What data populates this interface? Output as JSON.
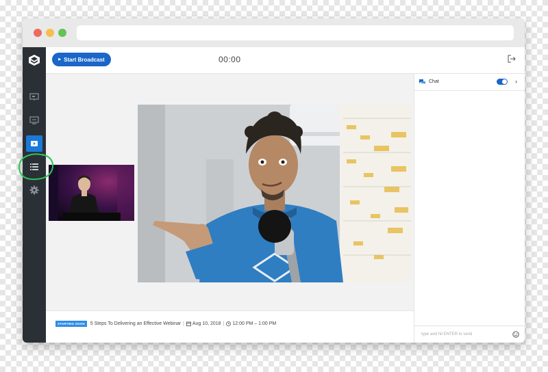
{
  "window": {
    "url": ""
  },
  "sidebar": {
    "items": [
      {
        "icon": "presentation-icon"
      },
      {
        "icon": "screen-share-icon"
      },
      {
        "icon": "video-camera-icon",
        "active": true
      },
      {
        "icon": "list-icon"
      },
      {
        "icon": "gear-icon"
      }
    ]
  },
  "toolbar": {
    "start_label": "Start Broadcast",
    "timer": "00:00"
  },
  "webinar": {
    "status_badge": "STARTING SOON",
    "title": "5 Steps To Delivering an Effective Webinar",
    "date": "Aug 10, 2018",
    "time": "12:00 PM – 1:00 PM"
  },
  "chat": {
    "title": "Chat",
    "toggle_on": true,
    "input_placeholder": "type and hit ENTER to send"
  },
  "colors": {
    "accent": "#1a66c9",
    "sidebar": "#2b3036",
    "badge": "#2e8ce6",
    "annotation": "#2ec45a"
  }
}
